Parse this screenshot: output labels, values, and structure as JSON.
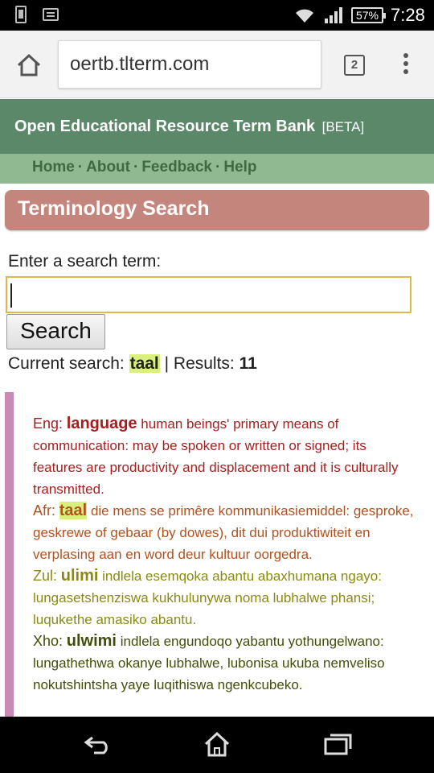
{
  "status_bar": {
    "battery": "57%",
    "time": "7:28",
    "icons": [
      "phone-icon",
      "message-icon",
      "wifi-icon",
      "signal-icon",
      "battery-icon"
    ]
  },
  "browser": {
    "url": "oertb.tlterm.com",
    "tab_count": "2",
    "icons": [
      "home-icon",
      "tabs-icon",
      "overflow-menu-icon"
    ]
  },
  "site": {
    "title": "Open Educational Resource Term Bank",
    "beta": "[BETA]",
    "nav": [
      "Home",
      "About",
      "Feedback",
      "Help"
    ],
    "nav_separator": "·"
  },
  "search": {
    "section_title": "Terminology Search",
    "label": "Enter a search term:",
    "input_value": "",
    "button": "Search",
    "current_label": "Current search:",
    "current_term": "taal",
    "results_label": "| Results:",
    "results_count": "11"
  },
  "result": {
    "entries": [
      {
        "lang": "Eng:",
        "term": "language",
        "definition": "human beings' primary means of communication: may be spoken or written or signed; its features are productivity and displacement and it is culturally transmitted."
      },
      {
        "lang": "Afr:",
        "term": "taal",
        "definition": "die mens se primêre kommunikasiemiddel: gesproke, geskrewe of gebaar (by dowes), dit dui produktiwiteit en verplasing aan en word deur kultuur oorgedra."
      },
      {
        "lang": "Zul:",
        "term": "ulimi",
        "definition": "indlela esemqoka abantu abaxhumana ngayo: lungasetshenziswa kukhulunywa noma lubhalwe phansi; luqukethe amasiko abantu."
      },
      {
        "lang": "Xho:",
        "term": "ulwimi",
        "definition": "indlela engundoqo yabantu yothungelwano: lungathethwa okanye lubhalwe, lubonisa ukuba nemveliso nokutshintsha yaye luqithiswa ngenkcubeko."
      }
    ]
  },
  "colors": {
    "header": "#5b8869",
    "nav": "#90b891",
    "section": "#c4857c",
    "highlight": "#d9f07c",
    "result_bar": "#c98ab6",
    "eng": "#a81e1e",
    "afr": "#b0521f",
    "zul": "#8a8a12",
    "xho": "#444e0a"
  },
  "android_nav": [
    "back-icon",
    "home-icon",
    "recents-icon"
  ]
}
